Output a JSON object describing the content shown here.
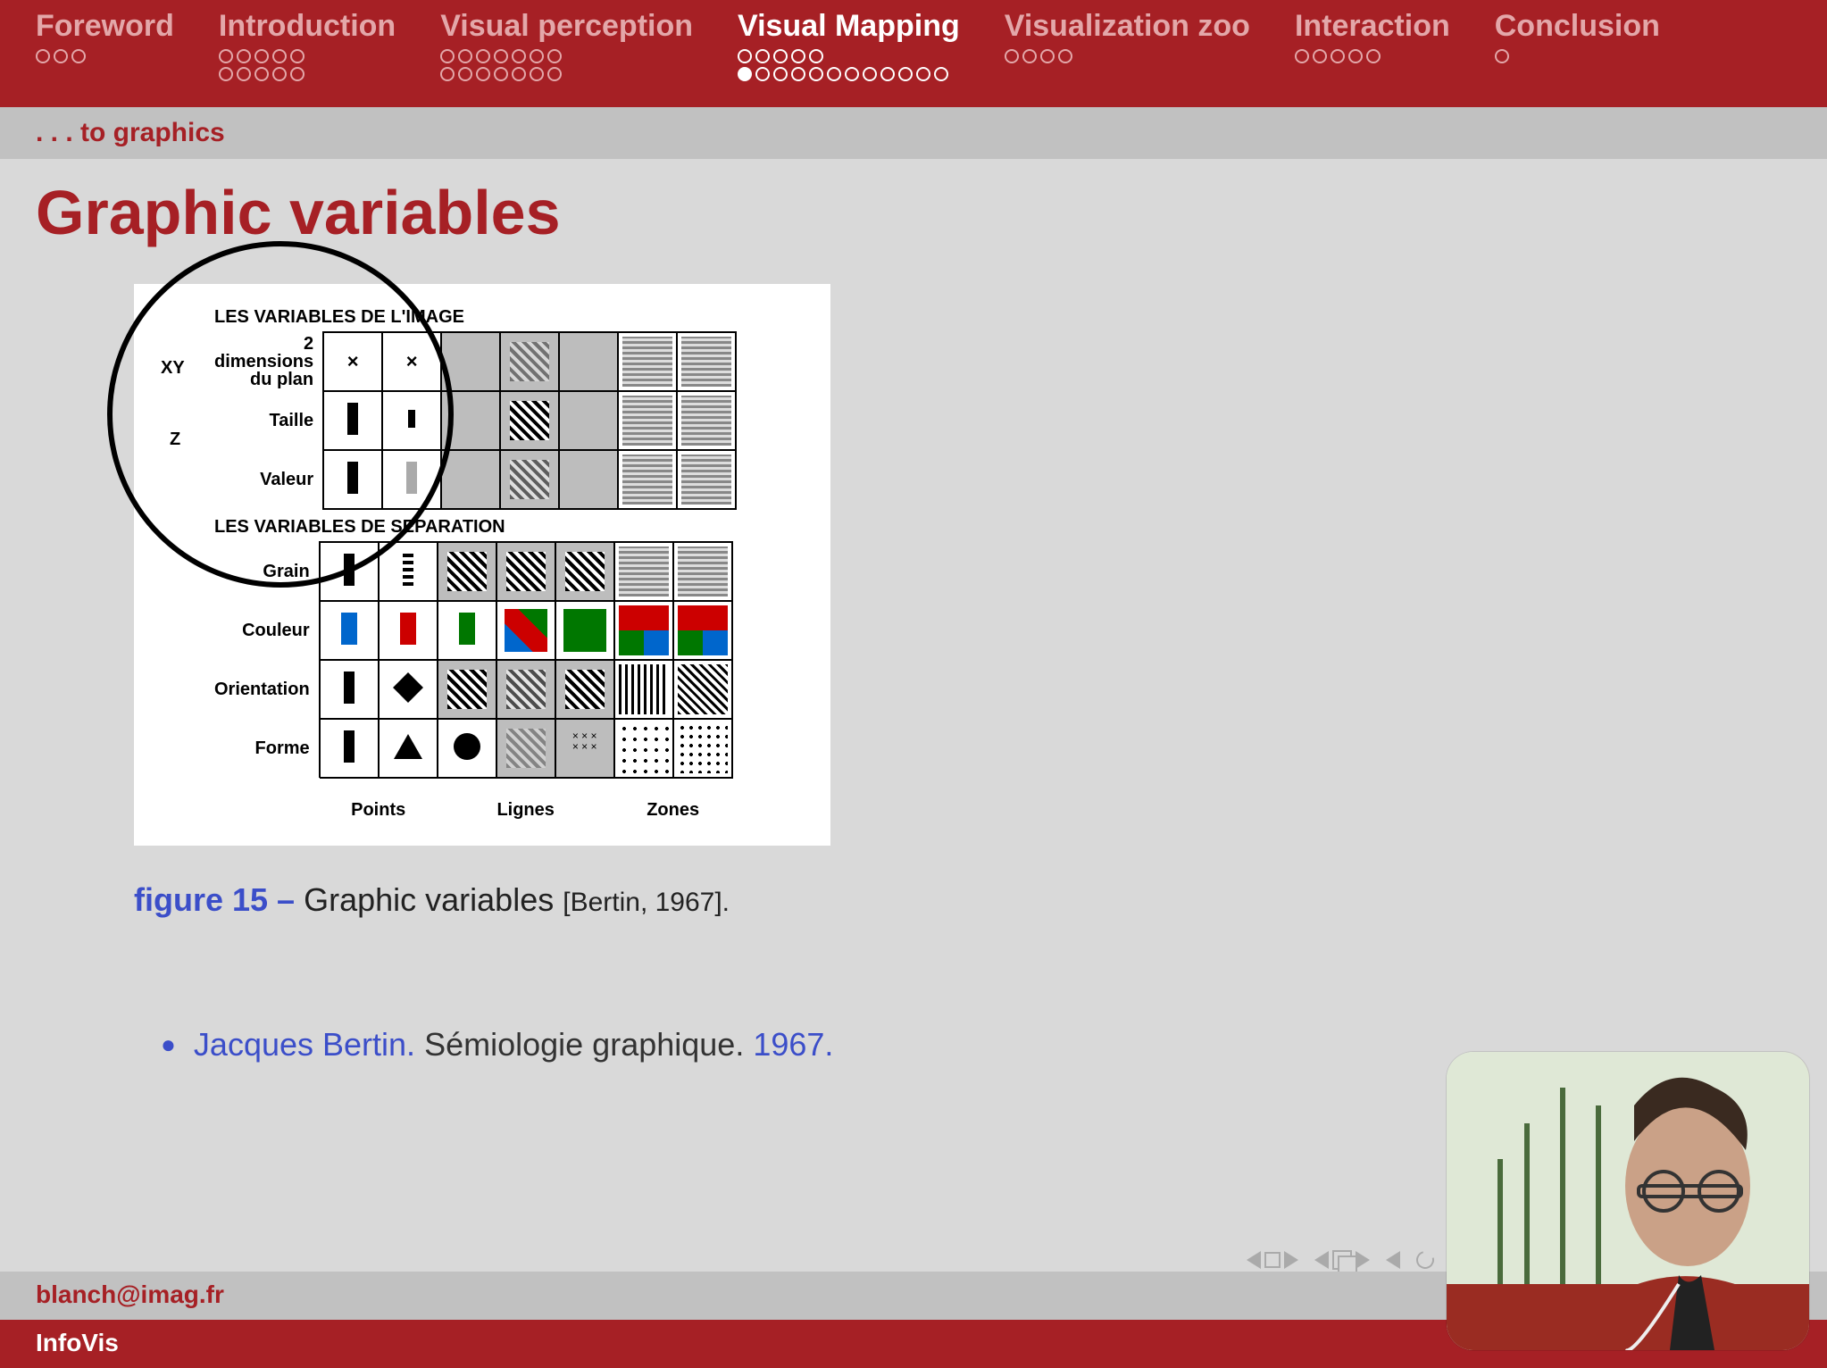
{
  "nav": {
    "sections": [
      {
        "label": "Foreword",
        "active": false,
        "rows": [
          [
            0,
            0,
            0
          ]
        ]
      },
      {
        "label": "Introduction",
        "active": false,
        "rows": [
          [
            0,
            0,
            0,
            0,
            0
          ],
          [
            0,
            0,
            0,
            0,
            0
          ]
        ]
      },
      {
        "label": "Visual perception",
        "active": false,
        "rows": [
          [
            0,
            0,
            0,
            0,
            0,
            0,
            0
          ],
          [
            0,
            0,
            0,
            0,
            0,
            0,
            0
          ]
        ]
      },
      {
        "label": "Visual Mapping",
        "active": true,
        "rows": [
          [
            0,
            0,
            0,
            0,
            0
          ],
          [
            1,
            0,
            0,
            0,
            0,
            0,
            0,
            0,
            0,
            0,
            0,
            0
          ]
        ]
      },
      {
        "label": "Visualization zoo",
        "active": false,
        "rows": [
          [
            0,
            0,
            0,
            0
          ]
        ]
      },
      {
        "label": "Interaction",
        "active": false,
        "rows": [
          [
            0,
            0,
            0,
            0,
            0
          ]
        ]
      },
      {
        "label": "Conclusion",
        "active": false,
        "rows": [
          [
            0
          ]
        ]
      }
    ]
  },
  "subheader": ". . . to graphics",
  "title": "Graphic variables",
  "figure": {
    "heading_image": "LES VARIABLES DE L'IMAGE",
    "heading_sep": "LES VARIABLES DE SEPARATION",
    "xy_label": "XY",
    "xy_desc1": "2",
    "xy_desc2": "dimensions",
    "xy_desc3": "du plan",
    "z_label": "Z",
    "rows": {
      "taille": "Taille",
      "valeur": "Valeur",
      "grain": "Grain",
      "couleur": "Couleur",
      "orientation": "Orientation",
      "forme": "Forme"
    },
    "col_points": "Points",
    "col_lignes": "Lignes",
    "col_zones": "Zones"
  },
  "caption": {
    "label": "figure 15 –",
    "text": "Graphic variables",
    "citation": "[Bertin, 1967]."
  },
  "reference": {
    "author": "Jacques Bertin.",
    "title": "Sémiologie graphique.",
    "year": "1967."
  },
  "footer": {
    "email": "blanch@imag.fr",
    "course": "InfoVis"
  }
}
